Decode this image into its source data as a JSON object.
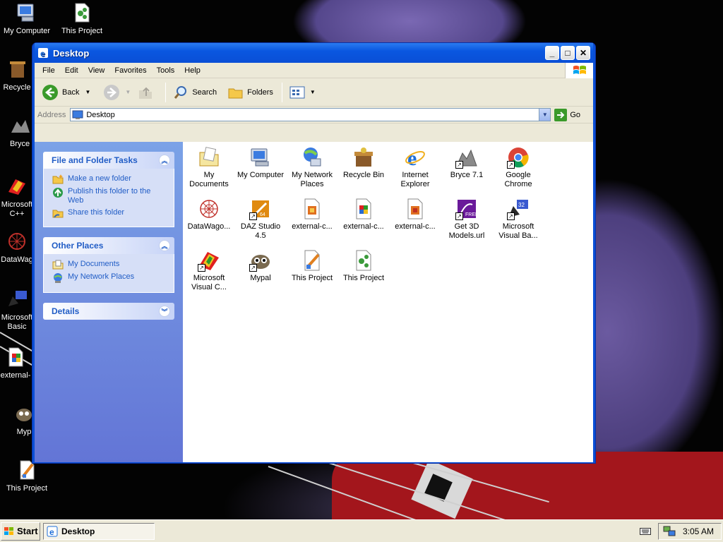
{
  "desktop_icons": [
    {
      "label": "My Computer",
      "icon": "my-computer-icon"
    },
    {
      "label": "This Project",
      "icon": "project-icon"
    },
    {
      "label": "Recycle",
      "icon": "recycle-bin-icon"
    },
    {
      "label": "Bryce",
      "icon": "bryce-icon"
    },
    {
      "label": "Microsoft\nC++",
      "icon": "visual-cpp-icon"
    },
    {
      "label": "DataWag",
      "icon": "datawagon-icon"
    },
    {
      "label": "Microsoft\nBasic",
      "icon": "visual-basic-icon"
    },
    {
      "label": "external-",
      "icon": "external-file-icon"
    },
    {
      "label": "Myp",
      "icon": "mypal-icon"
    },
    {
      "label": "This Project",
      "icon": "project-paint-icon"
    }
  ],
  "window": {
    "title": "Desktop",
    "buttons": {
      "minimize": "_",
      "maximize": "□",
      "close": "✕"
    }
  },
  "menubar": {
    "items": [
      "File",
      "Edit",
      "View",
      "Favorites",
      "Tools",
      "Help"
    ]
  },
  "toolbar": {
    "back_label": "Back",
    "search_label": "Search",
    "folders_label": "Folders"
  },
  "addressbar": {
    "label": "Address",
    "value": "Desktop",
    "go_label": "Go"
  },
  "taskpane": {
    "file_tasks": {
      "title": "File and Folder Tasks",
      "items": [
        "Make a new folder",
        "Publish this folder to the Web",
        "Share this folder"
      ]
    },
    "other_places": {
      "title": "Other Places",
      "items": [
        "My Documents",
        "My Network Places"
      ]
    },
    "details": {
      "title": "Details"
    }
  },
  "files": [
    {
      "label": "My\nDocuments",
      "icon": "my-documents-icon"
    },
    {
      "label": "My Computer",
      "icon": "my-computer-icon"
    },
    {
      "label": "My Network\nPlaces",
      "icon": "network-places-icon"
    },
    {
      "label": "Recycle Bin",
      "icon": "recycle-bin-icon"
    },
    {
      "label": "Internet\nExplorer",
      "icon": "internet-explorer-icon"
    },
    {
      "label": "Bryce 7.1",
      "icon": "bryce-icon"
    },
    {
      "label": "Google\nChrome",
      "icon": "chrome-icon"
    },
    {
      "label": "DataWago...",
      "icon": "datawagon-icon"
    },
    {
      "label": "DAZ Studio\n4.5",
      "icon": "daz-studio-icon"
    },
    {
      "label": "external-c...",
      "icon": "external-file-icon"
    },
    {
      "label": "external-c...",
      "icon": "external-file-icon"
    },
    {
      "label": "external-c...",
      "icon": "external-file-icon"
    },
    {
      "label": "Get 3D\nModels.url",
      "icon": "get-3d-models-icon"
    },
    {
      "label": "Microsoft\nVisual Ba...",
      "icon": "visual-basic-icon"
    },
    {
      "label": "Microsoft\nVisual C...",
      "icon": "visual-cpp-icon"
    },
    {
      "label": "Mypal",
      "icon": "mypal-icon"
    },
    {
      "label": "This Project",
      "icon": "project-paint-icon"
    },
    {
      "label": "This Project",
      "icon": "project-icon"
    }
  ],
  "taskbar": {
    "start_label": "Start",
    "task_label": "Desktop",
    "clock": "3:05 AM"
  }
}
